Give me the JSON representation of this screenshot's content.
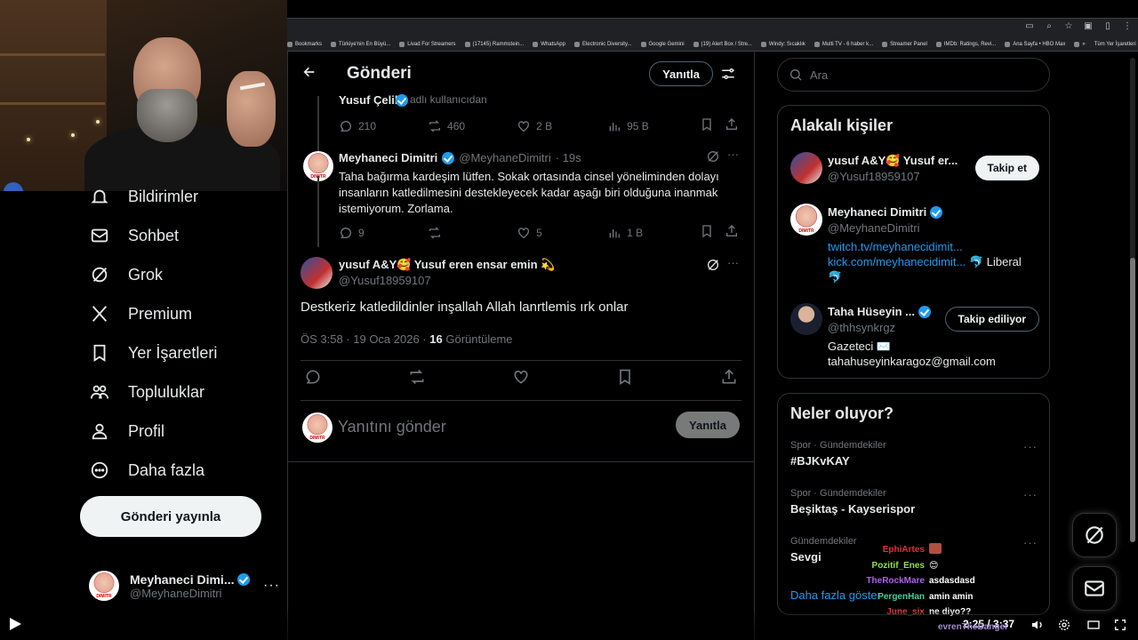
{
  "browser": {
    "bookmarks": [
      "Bookmarks",
      "Türkiye'nin En Büyü...",
      "Livad For Streamers",
      "(17145) Rammstein...",
      "WhatsApp",
      "Electronic Diversity...",
      "Google Gemini",
      "(19) Alert Box / Stre...",
      "Windy: Sıcaklık",
      "Multi TV - 6 haber k...",
      "Streamer Panel",
      "IMDb: Ratings, Revi...",
      "Ana Sayfa • HBO Max",
      "»"
    ],
    "bookmarks_folder": "Tüm Yer İşaretleri"
  },
  "sidebar": {
    "items": [
      {
        "label": "Bildirimler",
        "icon": "bell-icon"
      },
      {
        "label": "Sohbet",
        "icon": "mail-icon"
      },
      {
        "label": "Grok",
        "icon": "grok-icon"
      },
      {
        "label": "Premium",
        "icon": "x-logo-icon"
      },
      {
        "label": "Yer İşaretleri",
        "icon": "bookmark-icon"
      },
      {
        "label": "Topluluklar",
        "icon": "communities-icon"
      },
      {
        "label": "Profil",
        "icon": "profile-icon"
      },
      {
        "label": "Daha fazla",
        "icon": "more-circle-icon"
      }
    ],
    "post_button": "Gönderi yayınla",
    "account": {
      "name": "Meyhaneci Dimi...",
      "handle": "@MeyhaneDimitri"
    }
  },
  "main": {
    "title": "Gönderi",
    "reply_button": "Yanıtla",
    "prev_tweet": {
      "name": "Yusuf Çelik",
      "note": "adlı kullanıcıdan",
      "metrics": {
        "replies": "210",
        "reposts": "460",
        "likes": "2 B",
        "views": "95 B"
      }
    },
    "reply_tweet": {
      "name": "Meyhaneci Dimitri",
      "handle": "@MeyhaneDimitri",
      "time": "· 19s",
      "text": "Taha bağırma kardeşim lütfen. Sokak ortasında cinsel yöneliminden dolayı insanların katledilmesini destekleyecek kadar aşağı biri olduğuna inanmak istemiyorum. Zorlama.",
      "metrics": {
        "replies": "9",
        "reposts": "",
        "likes": "5",
        "views": "1 B"
      }
    },
    "focal_tweet": {
      "name": "yusuf A&Y🥰 Yusuf eren ensar emin 💫",
      "handle": "@Yusuf18959107",
      "text": "Destkeriz katledildinler inşallah Allah lanrtlemis ırk onlar",
      "time": "ÖS 3:58 · 19 Oca 2026 ·",
      "views_count": "16",
      "views_label": "Görüntüleme"
    },
    "composer": {
      "placeholder": "Yanıtını gönder",
      "button": "Yanıtla"
    }
  },
  "right": {
    "search_placeholder": "Ara",
    "relevant": {
      "title": "Alakalı kişiler",
      "people": [
        {
          "name": "yusuf A&Y🥰 Yusuf er...",
          "handle": "@Yusuf18959107",
          "button": "Takip et"
        },
        {
          "name": "Meyhaneci Dimitri",
          "handle": "@MeyhaneDimitri",
          "bio_link1": "twitch.tv/meyhanecidimit...",
          "bio_link2": "kick.com/meyhanecidimit...",
          "bio_rest": " 🐬 Liberal",
          "bio_line3": "🐬"
        },
        {
          "name": "Taha Hüseyin ...",
          "handle": "@thhsynkrgz",
          "bio1": "Gazeteci ✉️",
          "bio2": "tahahuseyinkaragoz@gmail.com",
          "button": "Takip ediliyor"
        }
      ]
    },
    "trends": {
      "title": "Neler oluyor?",
      "items": [
        {
          "cat": "Spor · Gündemdekiler",
          "name": "#BJKvKAY"
        },
        {
          "cat": "Spor · Gündemdekiler",
          "name": "Beşiktaş - Kayserispor"
        },
        {
          "cat": "Gündemdekiler",
          "name": "Sevgi"
        }
      ],
      "show_more": "Daha fazla göster"
    }
  },
  "chat": [
    {
      "user": "EphiArtes",
      "color": "#e0303a",
      "msg": ""
    },
    {
      "user": "Pozitif_Enes",
      "color": "#90e040",
      "msg": "😊"
    },
    {
      "user": "TheRockMare",
      "color": "#b060f0",
      "msg": "asdasdasd"
    },
    {
      "user": "PergenHan",
      "color": "#40d0a0",
      "msg": "amin amin"
    },
    {
      "user": "June_six",
      "color": "#e04040",
      "msg": "ne diyo??"
    }
  ],
  "chat_bottom_user": "evrenTheBanger",
  "video": {
    "time": "2:25 / 3:37"
  }
}
